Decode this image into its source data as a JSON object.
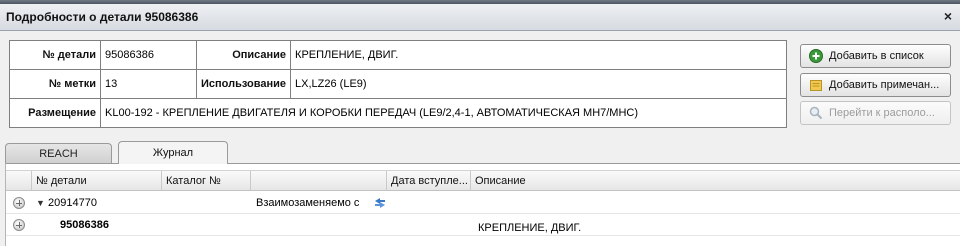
{
  "window": {
    "title": "Подробности о детали 95086386",
    "close_glyph": "×"
  },
  "info": {
    "part_no_label": "№ детали",
    "part_no_value": "95086386",
    "description_label": "Описание",
    "description_value": "КРЕПЛЕНИЕ,  ДВИГ.",
    "mark_no_label": "№ метки",
    "mark_no_value": "13",
    "usage_label": "Использование",
    "usage_value": "LX,LZ26 (LE9)",
    "placement_label": "Размещение",
    "placement_value": "KL00-192 - КРЕПЛЕНИЕ ДВИГАТЕЛЯ И КОРОБКИ ПЕРЕДАЧ (LE9/2,4-1, АВТОМАТИЧЕСКАЯ MH7/MHC)"
  },
  "buttons": {
    "add_to_list": "Добавить в список",
    "add_note": "Добавить примечан...",
    "go_to_location": "Перейти к располо..."
  },
  "tabs": [
    {
      "label": "REACH",
      "active": false
    },
    {
      "label": "Журнал",
      "active": true
    }
  ],
  "grid": {
    "columns": [
      "№ детали",
      "Каталог №",
      "",
      "Дата вступле...",
      "Описание"
    ],
    "rows": [
      {
        "part_no": "20914770",
        "expanded": true,
        "relation": "Взаимозаменяемо с",
        "description": ""
      },
      {
        "part_no": "95086386",
        "relation": "",
        "description": "КРЕПЛЕНИЕ, ДВИГ."
      }
    ]
  },
  "icons": {
    "add": "plus-circle-icon",
    "note": "note-icon",
    "goto": "magnifier-icon",
    "interchange": "interchange-icon",
    "expand": "expand-row-icon"
  },
  "colors": {
    "title_bar": "#dfe3e8",
    "body_bg": "#f0f0f0",
    "add_icon_green": "#3a9a3a",
    "note_icon_yellow": "#f2c94c",
    "interchange_blue": "#3a78c8"
  }
}
